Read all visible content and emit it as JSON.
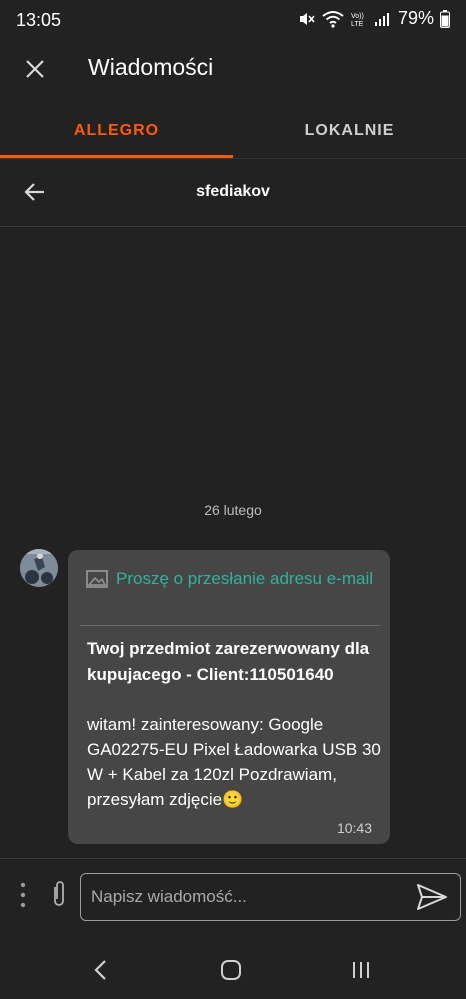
{
  "status_bar": {
    "time": "13:05",
    "battery": "79%",
    "icons": [
      "mute-icon",
      "wifi-icon",
      "volte-icon",
      "signal-icon",
      "battery-icon"
    ],
    "volte_label": "Vo)) LTE"
  },
  "app_bar": {
    "title": "Wiadomości",
    "close_icon": "close-icon"
  },
  "tabs": [
    {
      "label": "ALLEGRO",
      "active": true
    },
    {
      "label": "LOKALNIE",
      "active": false
    }
  ],
  "conversation": {
    "name": "sfediakov",
    "back_icon": "arrow-back-icon"
  },
  "messages": {
    "date_separator": "26 lutego",
    "items": [
      {
        "attachment_text": "Proszę o przesłanie adresu e-mail",
        "subject": "Twoj przedmiot zarezerwowany dla kupujacego - Client:110501640",
        "body": "witam! zainteresowany: Google GA02275-EU Pixel Ładowarka USB 30 W + Kabel za 120zl Pozdrawiam, przesyłam zdjęcie🙂",
        "time": "10:43"
      }
    ]
  },
  "composer": {
    "placeholder": "Napisz wiadomość...",
    "value": ""
  },
  "colors": {
    "background": "#222222",
    "accent": "#ff5a00",
    "link": "#2fb39c",
    "bubble": "#464646"
  }
}
